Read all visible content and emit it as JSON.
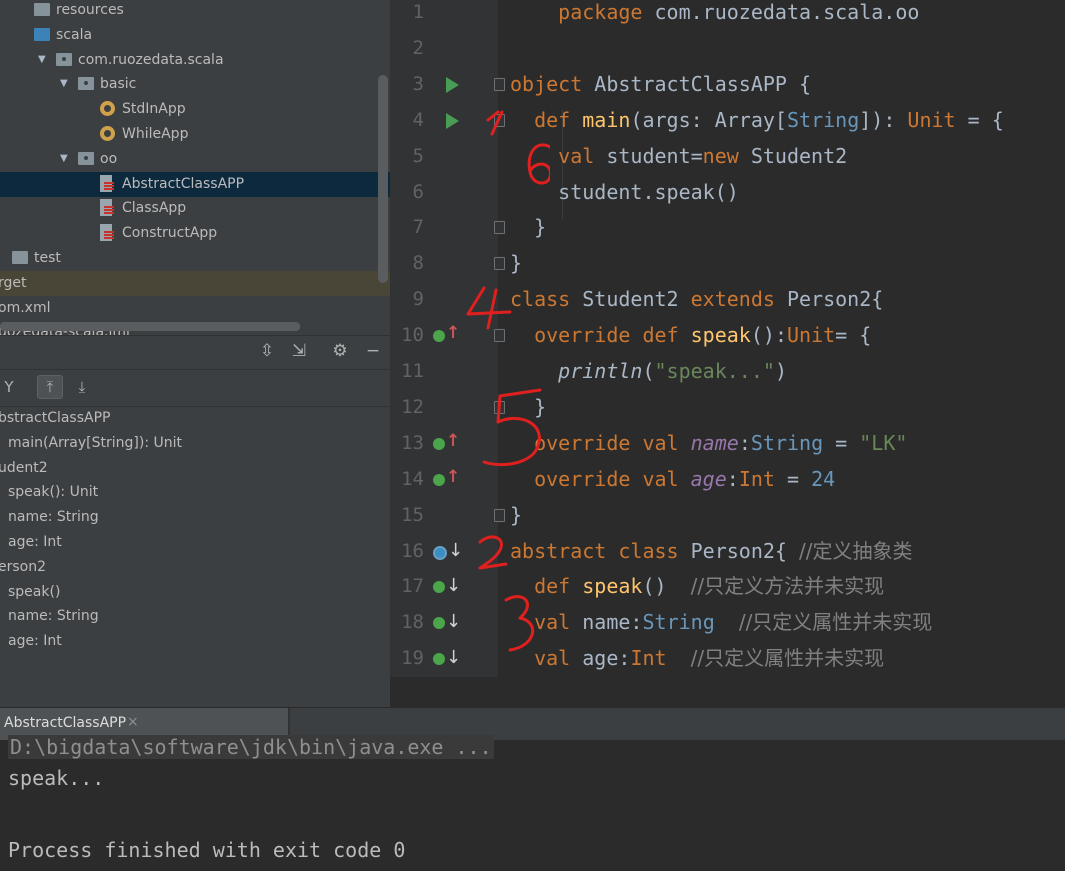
{
  "project_tree": [
    {
      "label": "resources",
      "icon": "folder-icon",
      "indent": 0
    },
    {
      "label": "scala",
      "icon": "folder-blue-icon",
      "indent": 0
    },
    {
      "label": "com.ruozedata.scala",
      "icon": "package-icon",
      "indent": 1,
      "expanded": true
    },
    {
      "label": "basic",
      "icon": "package-icon",
      "indent": 2,
      "expanded": true
    },
    {
      "label": "StdInApp",
      "icon": "scala-object-icon",
      "indent": 3
    },
    {
      "label": "WhileApp",
      "icon": "scala-object-icon",
      "indent": 3
    },
    {
      "label": "oo",
      "icon": "package-icon",
      "indent": 2,
      "expanded": true
    },
    {
      "label": "AbstractClassAPP",
      "icon": "scala-file-icon",
      "indent": 3,
      "selected": true
    },
    {
      "label": "ClassApp",
      "icon": "scala-file-icon",
      "indent": 3
    },
    {
      "label": "ConstructApp",
      "icon": "scala-file-icon",
      "indent": 3
    },
    {
      "label": "test",
      "icon": "folder-icon",
      "indent": -1
    },
    {
      "label": "rget",
      "icon": "none",
      "indent": -2,
      "excluded": true
    },
    {
      "label": "om.xml",
      "icon": "none",
      "indent": -2
    },
    {
      "label": "uozedata-scala.iml",
      "icon": "none",
      "indent": -2
    }
  ],
  "structure": {
    "header_icons": [
      "expand-all-icon",
      "collapse-all-icon",
      "gear-icon",
      "minimize-icon"
    ],
    "toolbar_icons": [
      "sort-icon",
      "show-inherited-icon",
      "autoscroll-icon"
    ],
    "items": [
      {
        "label": "bstractClassAPP",
        "indent": 0
      },
      {
        "label": "main(Array[String]): Unit",
        "indent": 1
      },
      {
        "label": "udent2",
        "indent": 0
      },
      {
        "label": "speak(): Unit",
        "indent": 1
      },
      {
        "label": "name: String",
        "indent": 1
      },
      {
        "label": "age: Int",
        "indent": 1
      },
      {
        "label": "erson2",
        "indent": 0
      },
      {
        "label": "speak()",
        "indent": 1
      },
      {
        "label": "name: String",
        "indent": 1
      },
      {
        "label": "age: Int",
        "indent": 1
      }
    ]
  },
  "editor": {
    "lines": [
      {
        "n": "1",
        "parts": [
          [
            "    ",
            ""
          ],
          [
            "package ",
            "kw"
          ],
          [
            "com.ruozedata.scala.oo",
            ""
          ]
        ]
      },
      {
        "n": "2",
        "parts": []
      },
      {
        "n": "3",
        "parts": [
          [
            "object ",
            "kw"
          ],
          [
            "AbstractClassAPP {",
            ""
          ]
        ],
        "run": true,
        "fold": true
      },
      {
        "n": "4",
        "parts": [
          [
            "  ",
            ""
          ],
          [
            "def ",
            "kw"
          ],
          [
            "main",
            "fn"
          ],
          [
            "(args: Array[",
            ""
          ],
          [
            "String",
            "ty"
          ],
          [
            "]): ",
            ""
          ],
          [
            "Unit",
            "kw"
          ],
          [
            " = {",
            ""
          ]
        ],
        "run": true,
        "fold": true
      },
      {
        "n": "5",
        "parts": [
          [
            "    ",
            ""
          ],
          [
            "val ",
            "kw"
          ],
          [
            "student=",
            ""
          ],
          [
            "new ",
            "kw"
          ],
          [
            "Student2",
            ""
          ]
        ]
      },
      {
        "n": "6",
        "parts": [
          [
            "    student.speak()",
            ""
          ]
        ]
      },
      {
        "n": "7",
        "parts": [
          [
            "  }",
            ""
          ]
        ],
        "fold": true
      },
      {
        "n": "8",
        "parts": [
          [
            "}",
            ""
          ]
        ],
        "fold": true
      },
      {
        "n": "9",
        "parts": [
          [
            "class ",
            "kw"
          ],
          [
            "Student2 ",
            ""
          ],
          [
            "extends ",
            "kw"
          ],
          [
            "Person2{",
            ""
          ]
        ]
      },
      {
        "n": "10",
        "parts": [
          [
            "  ",
            ""
          ],
          [
            "override def ",
            "kw"
          ],
          [
            "speak",
            "fn"
          ],
          [
            "():",
            ""
          ],
          [
            "Unit",
            "kw"
          ],
          [
            "= {",
            ""
          ]
        ],
        "gutter": "up",
        "fold": true
      },
      {
        "n": "11",
        "parts": [
          [
            "    ",
            ""
          ],
          [
            "println",
            "it"
          ],
          [
            "(",
            ""
          ],
          [
            "\"speak...\"",
            "str"
          ],
          [
            ")",
            ""
          ]
        ]
      },
      {
        "n": "12",
        "parts": [
          [
            "  }",
            ""
          ]
        ],
        "fold": true
      },
      {
        "n": "13",
        "parts": [
          [
            "  ",
            ""
          ],
          [
            "override val ",
            "kw"
          ],
          [
            "name",
            "par"
          ],
          [
            ":",
            ""
          ],
          [
            "String",
            "ty"
          ],
          [
            " = ",
            ""
          ],
          [
            "\"LK\"",
            "str"
          ]
        ],
        "gutter": "up"
      },
      {
        "n": "14",
        "parts": [
          [
            "  ",
            ""
          ],
          [
            "override val ",
            "kw"
          ],
          [
            "age",
            "par"
          ],
          [
            ":",
            ""
          ],
          [
            "Int",
            "kw"
          ],
          [
            " = ",
            ""
          ],
          [
            "24",
            "num"
          ]
        ],
        "gutter": "up"
      },
      {
        "n": "15",
        "parts": [
          [
            "}",
            ""
          ]
        ],
        "fold": true
      },
      {
        "n": "16",
        "parts": [
          [
            "abstract class ",
            "kw"
          ],
          [
            "Person2{ ",
            ""
          ],
          [
            "//定义抽象类",
            "cm"
          ]
        ],
        "gutter": "impl"
      },
      {
        "n": "17",
        "parts": [
          [
            "  ",
            ""
          ],
          [
            "def ",
            "kw"
          ],
          [
            "speak",
            "fn"
          ],
          [
            "()  ",
            ""
          ],
          [
            "//只定义方法并未实现",
            "cm"
          ]
        ],
        "gutter": "down"
      },
      {
        "n": "18",
        "parts": [
          [
            "  ",
            ""
          ],
          [
            "val ",
            "kw"
          ],
          [
            "name:",
            ""
          ],
          [
            "String",
            "ty"
          ],
          [
            "  ",
            ""
          ],
          [
            "//只定义属性并未实现",
            "cm"
          ]
        ],
        "gutter": "down"
      },
      {
        "n": "19",
        "parts": [
          [
            "  ",
            ""
          ],
          [
            "val ",
            "kw"
          ],
          [
            "age:",
            ""
          ],
          [
            "Int",
            "kw"
          ],
          [
            "  ",
            ""
          ],
          [
            "//只定义属性并未实现",
            "cm"
          ]
        ],
        "gutter": "down"
      }
    ]
  },
  "annotations": [
    "1",
    "6",
    "4",
    "5",
    "2",
    "3"
  ],
  "run": {
    "tab_label": "AbstractClassAPP",
    "tab_close": "×",
    "command": "D:\\bigdata\\software\\jdk\\bin\\java.exe ...",
    "output_line": "speak...",
    "exit_line": "Process finished with exit code 0"
  },
  "colors": {
    "keyword": "#cc7832",
    "function": "#ffc66d",
    "string": "#6a8759",
    "number": "#6897bb",
    "comment": "#808080",
    "annotation_red": "#e0201e"
  }
}
